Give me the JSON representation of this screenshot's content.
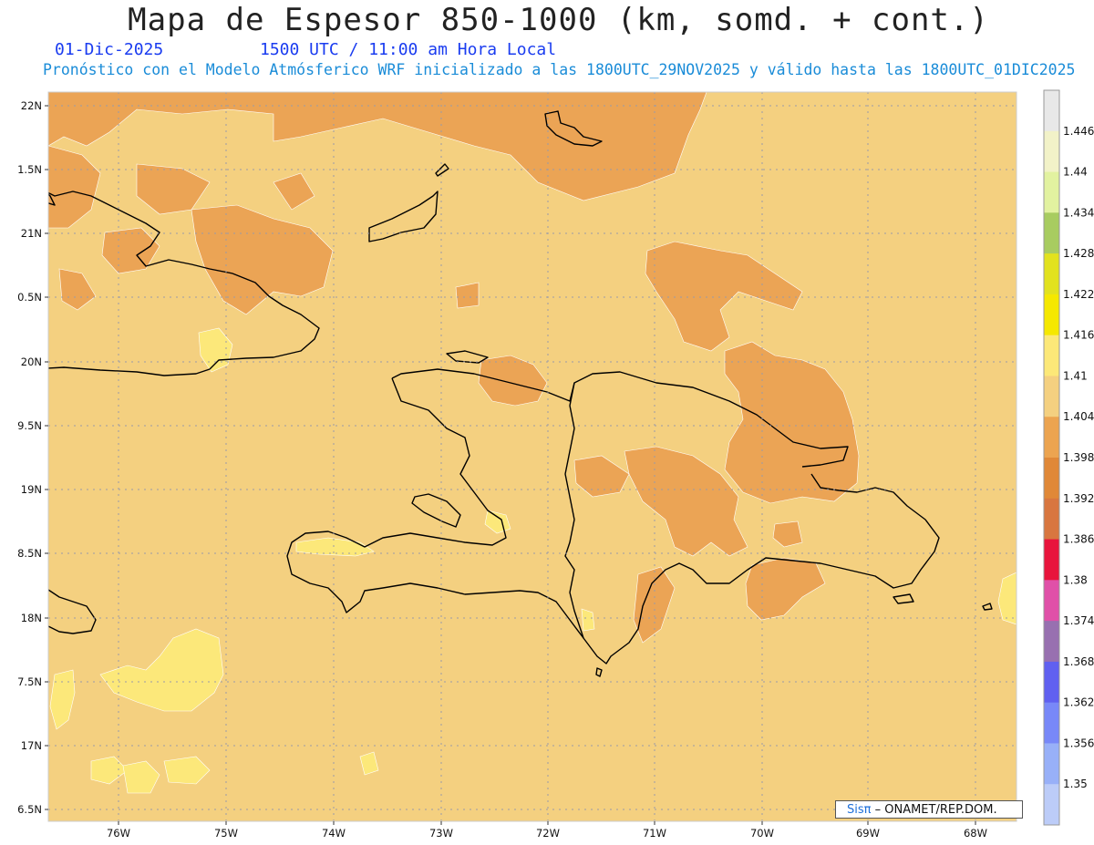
{
  "title": "Mapa de Espesor 850-1000 (km, somd. + cont.)",
  "date": "01-Dic-2025",
  "time": "1500 UTC / 11:00 am Hora Local",
  "subtitle": "Pronóstico con el Modelo Atmósferico WRF inicializado a las 1800UTC_29NOV2025 y válido hasta las  1800UTC_01DIC2025",
  "lon_ticks": [
    "76W",
    "75W",
    "74W",
    "73W",
    "72W",
    "71W",
    "70W",
    "69W",
    "68W"
  ],
  "lat_ticks": [
    "22N",
    "1.5N",
    "21N",
    "0.5N",
    "20N",
    "9.5N",
    "19N",
    "8.5N",
    "18N",
    "7.5N",
    "17N",
    "6.5N"
  ],
  "colorbar": {
    "labels": [
      "1.446",
      "1.44",
      "1.434",
      "1.428",
      "1.422",
      "1.416",
      "1.41",
      "1.404",
      "1.398",
      "1.392",
      "1.386",
      "1.38",
      "1.374",
      "1.368",
      "1.362",
      "1.356",
      "1.35"
    ],
    "colors": [
      "#e8e8e8",
      "#f2f2c8",
      "#e2f2a0",
      "#a8cc60",
      "#e2e21e",
      "#f5e800",
      "#fce878",
      "#f4d080",
      "#eca450",
      "#e08838",
      "#d87640",
      "#e8143c",
      "#e050a8",
      "#9870b0",
      "#6060f0",
      "#7888f8",
      "#98b0f8",
      "#bcccf8"
    ]
  },
  "credit": {
    "brand": "Sisπ",
    "text": " – ONAMET/REP.DOM."
  },
  "colors": {
    "base_field": "#f4d080",
    "warm_field": "#eba455",
    "cool_field": "#fce87a",
    "grid": "#9a9aa8"
  }
}
